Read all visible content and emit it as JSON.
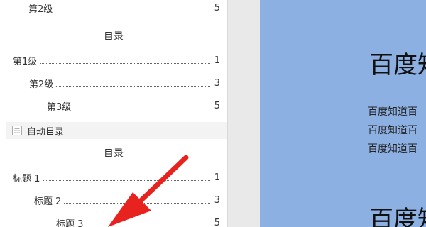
{
  "toc_panel": {
    "partial_entry": {
      "label": "第2级",
      "page": "5"
    },
    "toc_style_1": {
      "heading": "目录",
      "entries": [
        {
          "label": "第1级",
          "page": "1"
        },
        {
          "label": "第2级",
          "page": "3"
        },
        {
          "label": "第3级",
          "page": "5"
        }
      ]
    },
    "auto_section": {
      "title": "自动目录",
      "icon": "toc-document-icon",
      "heading": "目录",
      "entries": [
        {
          "label": "标题 1",
          "page": "1"
        },
        {
          "label": "标题 2",
          "page": "3"
        },
        {
          "label": "标题 3",
          "page": "5"
        }
      ]
    }
  },
  "document": {
    "title_1": "百度知",
    "paragraphs": [
      "百度知道百",
      "百度知道百",
      "百度知道百"
    ],
    "title_2": "百度知"
  },
  "colors": {
    "document_background": "#8db0e3",
    "arrow": "#e8231f",
    "section_bar": "#f3f3f3"
  }
}
